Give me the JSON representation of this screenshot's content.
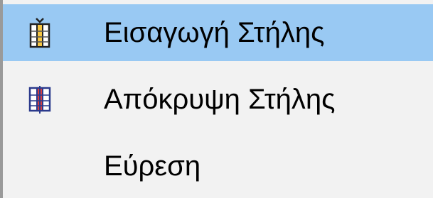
{
  "context_menu": {
    "items": [
      {
        "label": "Εισαγωγή Στήλης",
        "icon": "insert-column-icon",
        "highlighted": true
      },
      {
        "label": "Απόκρυψη Στήλης",
        "icon": "hide-column-icon",
        "highlighted": false
      },
      {
        "label": "Εύρεση",
        "icon": "",
        "highlighted": false
      }
    ]
  },
  "colors": {
    "highlight": "#99c9f3",
    "background": "#f2f2f2"
  }
}
